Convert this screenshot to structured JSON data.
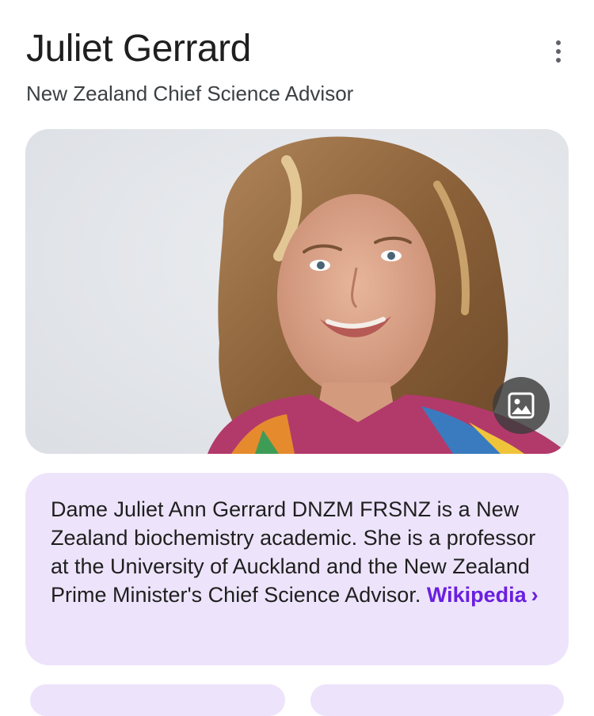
{
  "header": {
    "title": "Juliet Gerrard",
    "subtitle": "New Zealand Chief Science Advisor"
  },
  "menu": {
    "icon": "more-vertical-icon"
  },
  "photo": {
    "alt": "Juliet Gerrard",
    "badge_icon": "image-icon"
  },
  "description": {
    "text": "Dame Juliet Ann Gerrard DNZM FRSNZ is a New Zealand biochemistry academic. She is a professor at the University of Auckland and the New Zealand Prime Minister's Chief Science Advisor.",
    "source_label": "Wikipedia",
    "source_chevron": "›"
  },
  "colors": {
    "card_background": "#ede4fb",
    "link": "#6a1fe0"
  }
}
